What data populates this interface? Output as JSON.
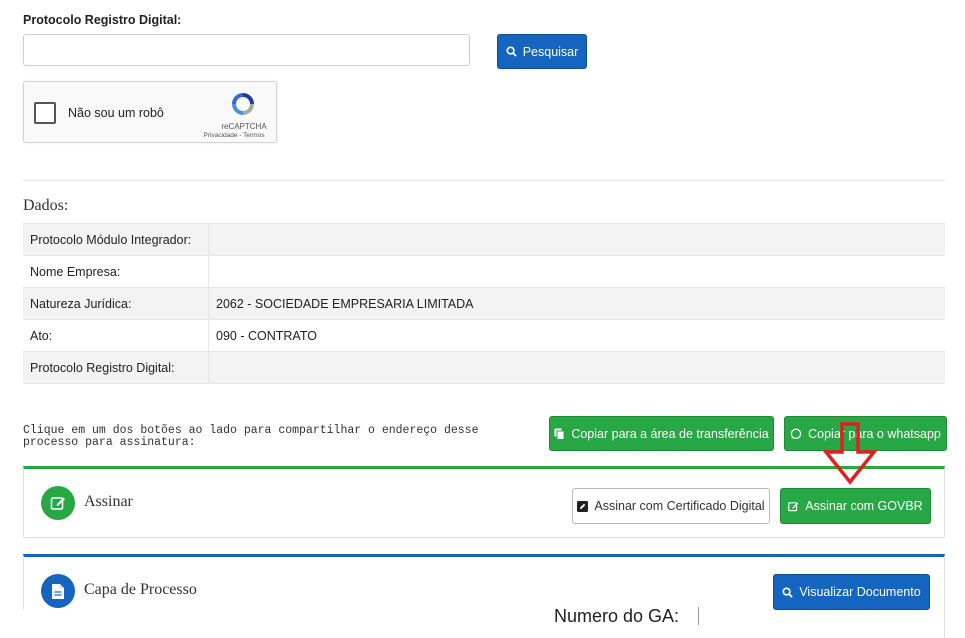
{
  "search": {
    "label": "Protocolo Registro Digital:",
    "value": "",
    "button_label": "Pesquisar"
  },
  "recaptcha": {
    "checkbox_label": "Não sou um robô",
    "brand": "reCAPTCHA",
    "links": "Privacidade - Termos"
  },
  "dados": {
    "title": "Dados:",
    "rows": [
      {
        "key": "Protocolo Módulo Integrador:",
        "value": ""
      },
      {
        "key": "Nome Empresa:",
        "value": ""
      },
      {
        "key": "Natureza Jurídica:",
        "value": "2062 - SOCIEDADE EMPRESARIA LIMITADA"
      },
      {
        "key": "Ato:",
        "value": "090 - CONTRATO"
      },
      {
        "key": "Protocolo Registro Digital:",
        "value": ""
      }
    ]
  },
  "share": {
    "text": "Clique em um dos botões ao lado para compartilhar o endereço desse processo para assinatura:",
    "copy_label": "Copiar para a área de transferência",
    "whatsapp_label": "Copiar para o whatsapp"
  },
  "sign_panel": {
    "title": "Assinar",
    "cert_label": "Assinar com Certificado Digital",
    "govbr_label": "Assinar com GOVBR"
  },
  "capa_panel": {
    "title": "Capa de Processo",
    "view_label": "Visualizar Documento"
  },
  "numero_ga_label": "Numero do GA:",
  "colors": {
    "primary_blue": "#1565c0",
    "success_green": "#28a745",
    "arrow_red": "#e02020"
  }
}
